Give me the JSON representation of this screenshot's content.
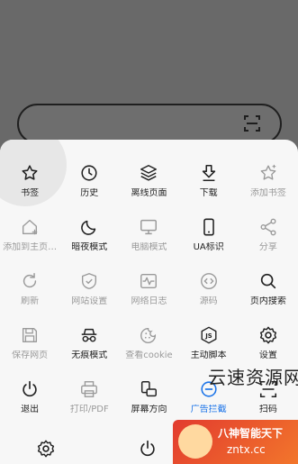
{
  "menu": {
    "items": [
      {
        "label": "书签",
        "icon": "star-icon",
        "state": "active"
      },
      {
        "label": "历史",
        "icon": "clock-icon",
        "state": "active"
      },
      {
        "label": "离线页面",
        "icon": "layers-icon",
        "state": "active"
      },
      {
        "label": "下载",
        "icon": "download-icon",
        "state": "active"
      },
      {
        "label": "添加书签",
        "icon": "star-plus-icon",
        "state": "disabled"
      },
      {
        "label": "添加到主页…",
        "icon": "home-plus-icon",
        "state": "disabled"
      },
      {
        "label": "暗夜模式",
        "icon": "moon-icon",
        "state": "active"
      },
      {
        "label": "电脑模式",
        "icon": "monitor-icon",
        "state": "disabled"
      },
      {
        "label": "UA标识",
        "icon": "phone-icon",
        "state": "active"
      },
      {
        "label": "分享",
        "icon": "share-icon",
        "state": "disabled"
      },
      {
        "label": "刷新",
        "icon": "refresh-icon",
        "state": "disabled"
      },
      {
        "label": "网站设置",
        "icon": "shield-check-icon",
        "state": "disabled"
      },
      {
        "label": "网络日志",
        "icon": "pulse-icon",
        "state": "disabled"
      },
      {
        "label": "源码",
        "icon": "code-icon",
        "state": "disabled"
      },
      {
        "label": "页内搜索",
        "icon": "search-icon",
        "state": "active"
      },
      {
        "label": "保存网页",
        "icon": "save-icon",
        "state": "disabled"
      },
      {
        "label": "无痕模式",
        "icon": "incognito-icon",
        "state": "active"
      },
      {
        "label": "查看cookie",
        "icon": "cookie-icon",
        "state": "disabled"
      },
      {
        "label": "主动脚本",
        "icon": "js-icon",
        "state": "active"
      },
      {
        "label": "设置",
        "icon": "gear-icon",
        "state": "active"
      },
      {
        "label": "退出",
        "icon": "power-icon",
        "state": "active"
      },
      {
        "label": "打印/PDF",
        "icon": "printer-icon",
        "state": "disabled"
      },
      {
        "label": "屏幕方向",
        "icon": "rotate-icon",
        "state": "active"
      },
      {
        "label": "广告拦截",
        "icon": "block-icon",
        "state": "accent"
      },
      {
        "label": "扫码",
        "icon": "scan-icon",
        "state": "active"
      }
    ]
  },
  "watermark": {
    "site_name": "云速资源网",
    "badge_title": "八神智能天下",
    "badge_url": "zntx.cc"
  },
  "colors": {
    "accent": "#1a73e8",
    "disabled": "#9a9a9a",
    "enabled": "#222222",
    "panel": "#f7f7f7",
    "backdrop": "#696969"
  }
}
